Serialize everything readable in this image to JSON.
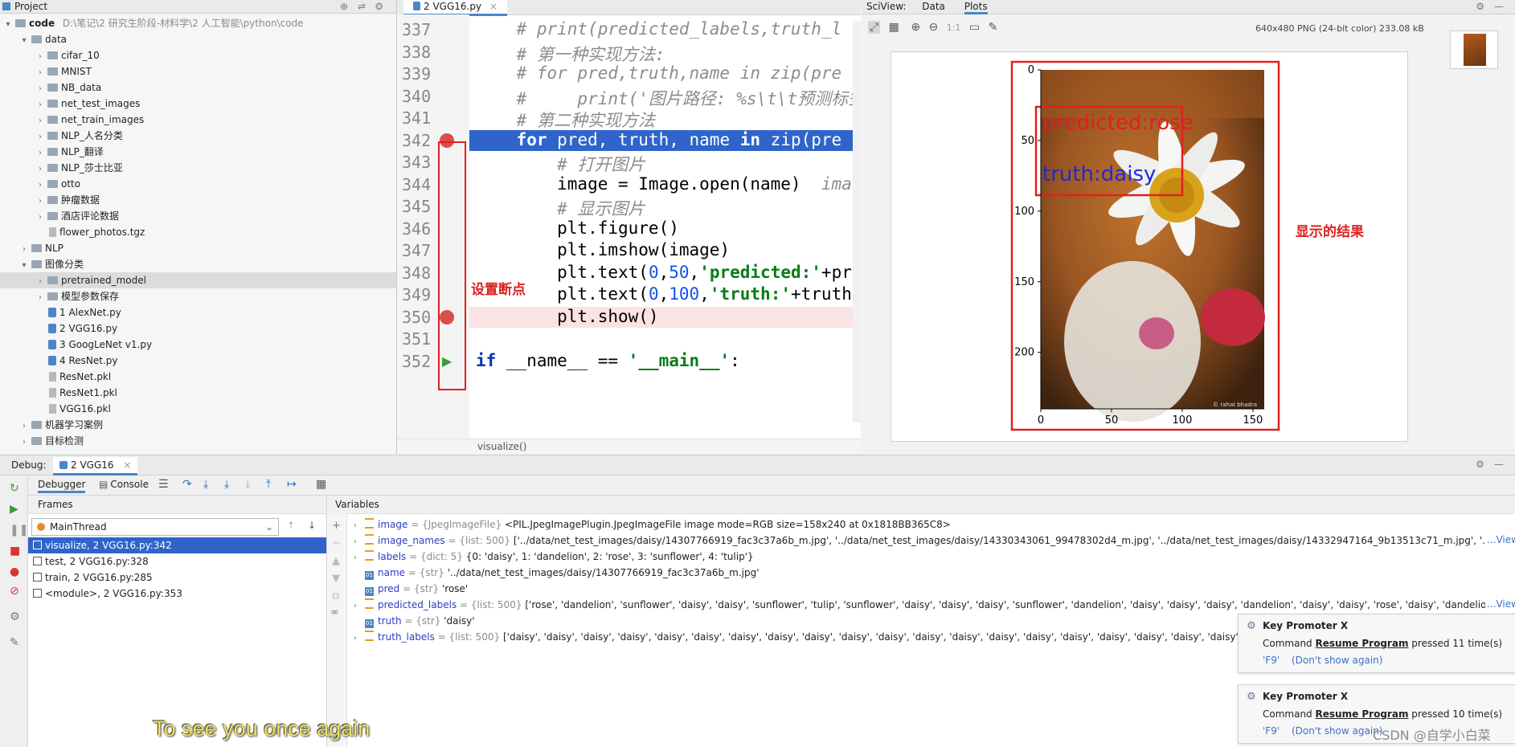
{
  "project": {
    "title": "Project",
    "root_name": "code",
    "root_path": "D:\\笔记\\2 研究生阶段-材料学\\2 人工智能\\python\\code",
    "items": [
      {
        "label": "data",
        "depth": 1,
        "type": "folder",
        "expanded": true
      },
      {
        "label": "cifar_10",
        "depth": 2,
        "type": "folder"
      },
      {
        "label": "MNIST",
        "depth": 2,
        "type": "folder"
      },
      {
        "label": "NB_data",
        "depth": 2,
        "type": "folder"
      },
      {
        "label": "net_test_images",
        "depth": 2,
        "type": "folder"
      },
      {
        "label": "net_train_images",
        "depth": 2,
        "type": "folder"
      },
      {
        "label": "NLP_人名分类",
        "depth": 2,
        "type": "folder"
      },
      {
        "label": "NLP_翻译",
        "depth": 2,
        "type": "folder"
      },
      {
        "label": "NLP_莎士比亚",
        "depth": 2,
        "type": "folder"
      },
      {
        "label": "otto",
        "depth": 2,
        "type": "folder"
      },
      {
        "label": "肿瘤数据",
        "depth": 2,
        "type": "folder"
      },
      {
        "label": "酒店评论数据",
        "depth": 2,
        "type": "folder"
      },
      {
        "label": "flower_photos.tgz",
        "depth": 2,
        "type": "archive"
      },
      {
        "label": "NLP",
        "depth": 1,
        "type": "folder"
      },
      {
        "label": "图像分类",
        "depth": 1,
        "type": "folder",
        "expanded": true
      },
      {
        "label": "pretrained_model",
        "depth": 2,
        "type": "folder"
      },
      {
        "label": "模型参数保存",
        "depth": 2,
        "type": "folder"
      },
      {
        "label": "1 AlexNet.py",
        "depth": 2,
        "type": "py"
      },
      {
        "label": "2 VGG16.py",
        "depth": 2,
        "type": "py"
      },
      {
        "label": "3 GoogLeNet v1.py",
        "depth": 2,
        "type": "py"
      },
      {
        "label": "4 ResNet.py",
        "depth": 2,
        "type": "py"
      },
      {
        "label": "ResNet.pkl",
        "depth": 2,
        "type": "pkl"
      },
      {
        "label": "ResNet1.pkl",
        "depth": 2,
        "type": "pkl"
      },
      {
        "label": "VGG16.pkl",
        "depth": 2,
        "type": "pkl"
      },
      {
        "label": "机器学习案例",
        "depth": 1,
        "type": "folder"
      },
      {
        "label": "目标检测",
        "depth": 1,
        "type": "folder"
      }
    ]
  },
  "editor": {
    "tab": "2 VGG16.py",
    "breadcrumb": "visualize()",
    "annotation": "设置断点",
    "lines": [
      {
        "n": "337",
        "html": "<span class='cm'>    # print(predicted_labels,truth_l</span>"
      },
      {
        "n": "338",
        "html": "<span class='cm'>    # 第一种实现方法:</span>"
      },
      {
        "n": "339",
        "html": "<span class='cm'>    # for pred,truth,name in zip(pre</span>"
      },
      {
        "n": "340",
        "html": "<span class='cm'>    #     print('图片路径: %s\\t\\t预测标签</span>"
      },
      {
        "n": "341",
        "html": "<span class='cm'>    # 第二种实现方法</span>"
      },
      {
        "n": "342",
        "html": "    <span class='kw'>for</span> pred, truth, name <span class='kw'>in</span> zip(pre"
      },
      {
        "n": "343",
        "html": "<span class='cm'>        # 打开图片</span>"
      },
      {
        "n": "344",
        "html": "        image = Image.open(name)  <span class='cm'>ima</span>"
      },
      {
        "n": "345",
        "html": "<span class='cm'>        # 显示图片</span>"
      },
      {
        "n": "346",
        "html": "        plt.figure()"
      },
      {
        "n": "347",
        "html": "        plt.imshow(image)"
      },
      {
        "n": "348",
        "html": "        plt.text(<span class='num'>0</span>,<span class='num'>50</span>,<span class='str'>'predicted:'</span>+pr"
      },
      {
        "n": "349",
        "html": "        plt.text(<span class='num'>0</span>,<span class='num'>100</span>,<span class='str'>'truth:'</span>+truth"
      },
      {
        "n": "350",
        "html": "        plt.show()"
      },
      {
        "n": "351",
        "html": ""
      },
      {
        "n": "352",
        "html": "<span class='kw'>if</span> __name__ == <span class='str'>'__main__'</span>:"
      }
    ]
  },
  "sciview": {
    "label": "SciView:",
    "tabs": [
      "Data",
      "Plots"
    ],
    "image_info": "640x480 PNG (24-bit color) 233.08 kB",
    "annotation": "显示的结果",
    "plot": {
      "predicted_text": "predicted:rose",
      "truth_text": "truth:daisy",
      "y_ticks": [
        "0",
        "50",
        "100",
        "150",
        "200"
      ],
      "x_ticks": [
        "0",
        "50",
        "100",
        "150"
      ],
      "watermark": "© rahat bhadra"
    }
  },
  "debug": {
    "label": "Debug:",
    "config": "2 VGG16",
    "tabs": [
      "Debugger",
      "Console"
    ],
    "frames_title": "Frames",
    "variables_title": "Variables",
    "thread": "MainThread",
    "frames": [
      "visualize, 2 VGG16.py:342",
      "test, 2 VGG16.py:328",
      "train, 2 VGG16.py:285",
      "<module>, 2 VGG16.py:353"
    ],
    "variables": [
      {
        "name": "image",
        "type": " = {JpegImageFile} ",
        "value": "<PIL.JpegImagePlugin.JpegImageFile image mode=RGB size=158x240 at 0x1818BB365C8>",
        "expand": true
      },
      {
        "name": "image_names",
        "type": " = {list: 500} ",
        "value": "['../data/net_test_images/daisy/14307766919_fac3c37a6b_m.jpg', '../data/net_test_images/daisy/14330343061_99478302d4_m.jpg', '../data/net_test_images/daisy/14332947164_9b13513c71_m.jpg', '../data/net_test",
        "expand": true,
        "view": "...View"
      },
      {
        "name": "labels",
        "type": " = {dict: 5} ",
        "value": "{0: 'daisy', 1: 'dandelion', 2: 'rose', 3: 'sunflower', 4: 'tulip'}",
        "expand": true
      },
      {
        "name": "name",
        "type": " = {str} ",
        "value": "'../data/net_test_images/daisy/14307766919_fac3c37a6b_m.jpg'",
        "expand": false
      },
      {
        "name": "pred",
        "type": " = {str} ",
        "value": "'rose'",
        "expand": false
      },
      {
        "name": "predicted_labels",
        "type": " = {list: 500} ",
        "value": "['rose', 'dandelion', 'sunflower', 'daisy', 'daisy', 'sunflower', 'tulip', 'sunflower', 'daisy', 'daisy', 'daisy', 'sunflower', 'dandelion', 'daisy', 'daisy', 'daisy', 'dandelion', 'daisy', 'daisy', 'rose', 'daisy', 'dandelion', 'daisy', 'c",
        "expand": true,
        "view": "...View"
      },
      {
        "name": "truth",
        "type": " = {str} ",
        "value": "'daisy'",
        "expand": false
      },
      {
        "name": "truth_labels",
        "type": " = {list: 500} ",
        "value": "['daisy', 'daisy', 'daisy', 'daisy', 'daisy', 'daisy', 'daisy', 'daisy', 'daisy', 'daisy', 'daisy', 'daisy', 'daisy', 'daisy', 'daisy', 'daisy', 'daisy', 'daisy', 'daisy', 'daisy',",
        "expand": true
      }
    ]
  },
  "notifications": [
    {
      "title": "Key Promoter X",
      "prefix": "Command ",
      "action": "Resume Program",
      "suffix": " pressed 11 time(s)",
      "shortcut": "'F9'",
      "dismiss": "(Don't show again)"
    },
    {
      "title": "Key Promoter X",
      "prefix": "Command ",
      "action": "Resume Program",
      "suffix": " pressed 10 time(s)",
      "shortcut": "'F9'",
      "dismiss": "(Don't show again)"
    }
  ],
  "overlay": {
    "subtitle": "To see you once again",
    "watermark": "CSDN @自学小白菜"
  },
  "colors": {
    "selection": "#2f65ca",
    "annotation_red": "#e02020",
    "breakpoint": "#db4c4c"
  }
}
